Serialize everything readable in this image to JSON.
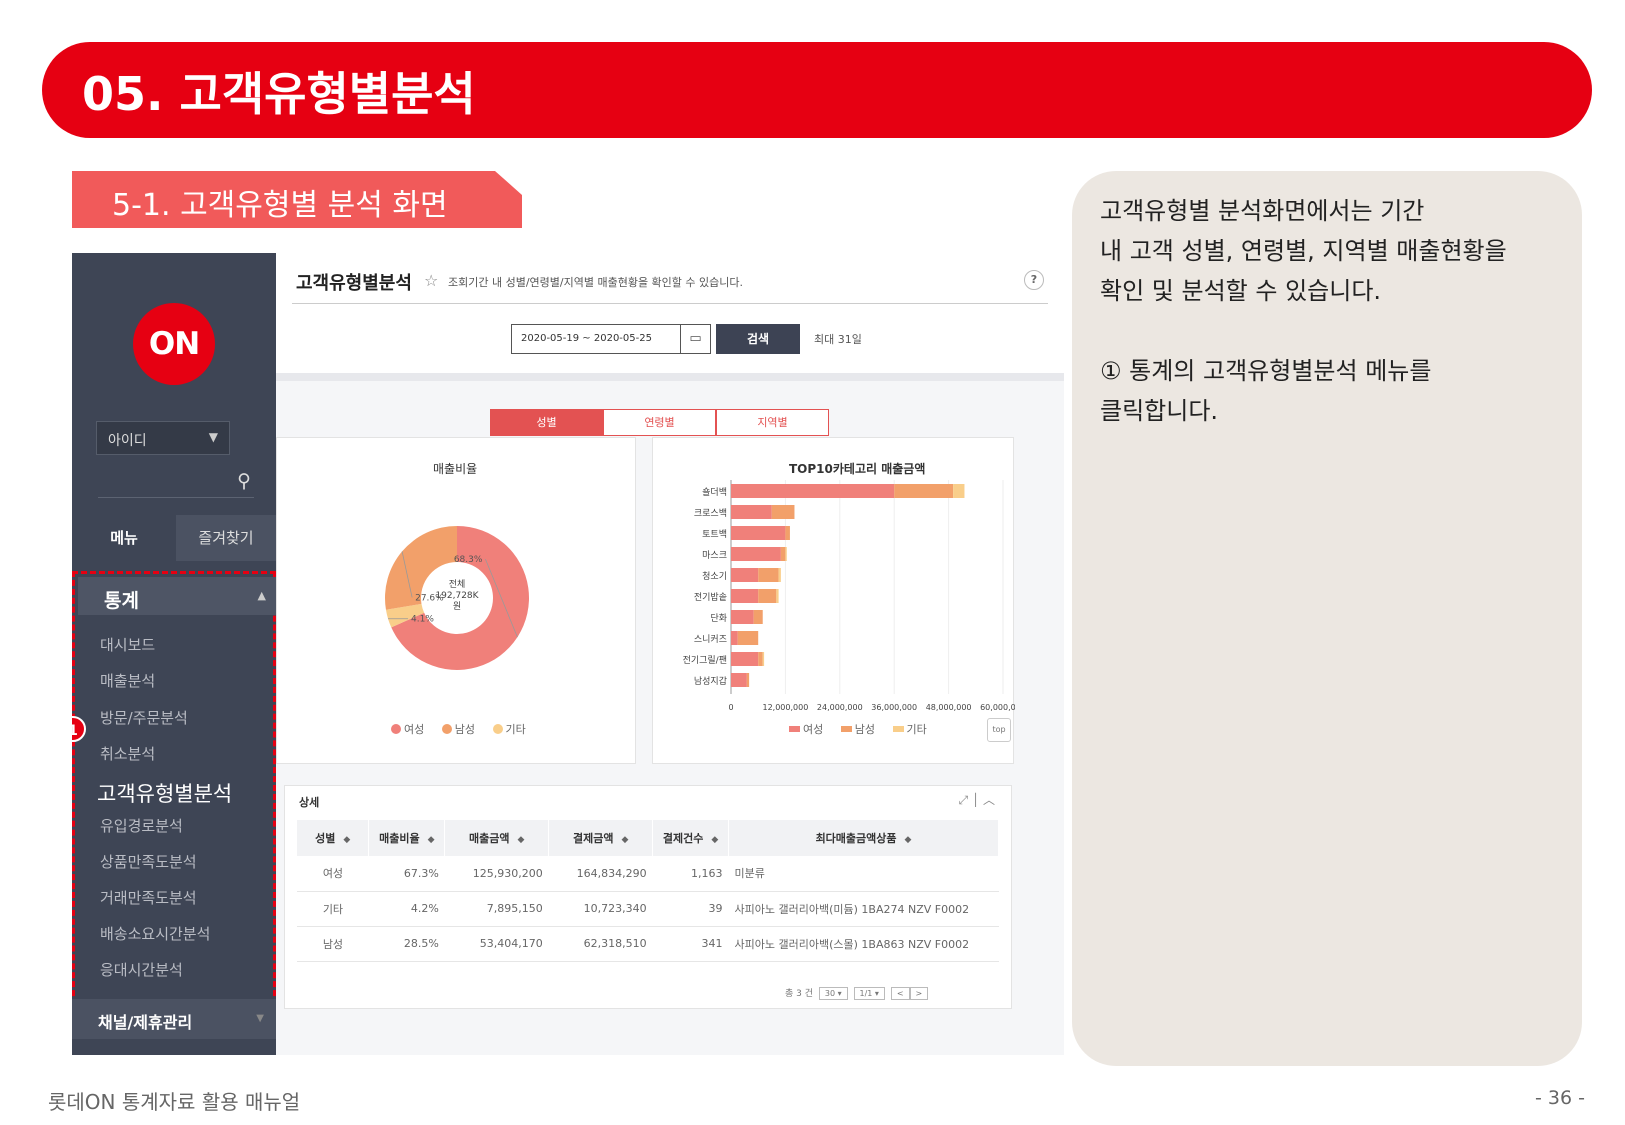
{
  "banner_title": "05. 고객유형별분석",
  "section_title": "5-1. 고객유형별 분석 화면",
  "description": [
    "고객유형별 분석화면에서는 기간",
    "내 고객 성별, 연령별, 지역별 매출현황을",
    "확인 및 분석할 수 있습니다.",
    "① 통계의 고객유형별분석 메뉴를",
    "클릭합니다."
  ],
  "footer": {
    "left": "롯데ON 통계자료 활용 매뉴얼",
    "right": "- 36 -"
  },
  "app": {
    "logo_text": "ON",
    "id_select": "아이디",
    "tabs": {
      "menu": "메뉴",
      "favorites": "즐겨찾기"
    },
    "group_title": "통계",
    "menu_items": [
      "대시보드",
      "매출분석",
      "방문/주문분석",
      "취소분석",
      "고객유형별분석",
      "유입경로분석",
      "상품만족도분석",
      "거래만족도분석",
      "배송소요시간분석",
      "응대시간분석"
    ],
    "active_index": 4,
    "badge": "1",
    "next_group": "채널/제휴관리"
  },
  "page": {
    "title": "고객유형별분석",
    "desc": "조회기간 내 성별/연령별/지역별 매출현황을 확인할 수 있습니다.",
    "help": "?",
    "date_range": "2020-05-19 ~ 2020-05-25",
    "search_label": "검색",
    "max_days": "최대 31일",
    "segments": [
      "성별",
      "연령별",
      "지역별"
    ],
    "selected_segment": "성별",
    "colors": {
      "female": "#f0807a",
      "male": "#f2a06a",
      "other": "#f9ce8a",
      "accent": "#e35252"
    }
  },
  "chart_data": [
    {
      "type": "pie",
      "title": "매출비율",
      "center_label": [
        "전체",
        "192,728K",
        "원"
      ],
      "labels": [
        "여성",
        "남성",
        "기타"
      ],
      "values": [
        68.3,
        27.6,
        4.1
      ],
      "value_labels": [
        "68.3%",
        "27.6%",
        "4.1%"
      ]
    },
    {
      "type": "bar",
      "orientation": "horizontal",
      "stacked": true,
      "title": "TOP10카테고리 매출금액",
      "categories": [
        "숄더백",
        "크로스백",
        "토트백",
        "마스크",
        "청소기",
        "전기밥솥",
        "단화",
        "스니커즈",
        "전기그릴/팬",
        "남성지갑"
      ],
      "series": [
        {
          "name": "여성",
          "values": [
            36000000,
            9000000,
            12000000,
            11000000,
            6000000,
            6000000,
            5000000,
            1500000,
            6000000,
            3500000
          ]
        },
        {
          "name": "남성",
          "values": [
            13000000,
            5000000,
            1000000,
            1000000,
            4500000,
            4000000,
            2000000,
            4500000,
            1000000,
            500000
          ]
        },
        {
          "name": "기타",
          "values": [
            2500000,
            0,
            0,
            300000,
            500000,
            500000,
            0,
            0,
            300000,
            0
          ]
        }
      ],
      "xlim": [
        0,
        60000000
      ],
      "x_ticks": [
        "0",
        "12,000,000",
        "24,000,000",
        "36,000,000",
        "48,000,000",
        "60,000,000"
      ],
      "grid": true,
      "legend": "bottom"
    }
  ],
  "top_button": "top",
  "detail": {
    "title": "상세",
    "headers": [
      "성별",
      "매출비율",
      "매출금액",
      "결제금액",
      "결제건수",
      "최다매출금액상품"
    ],
    "rows": [
      [
        "여성",
        "67.3%",
        "125,930,200",
        "164,834,290",
        "1,163",
        "미분류"
      ],
      [
        "기타",
        "4.2%",
        "7,895,150",
        "10,723,340",
        "39",
        "사피아노 갤러리아백(미듐) 1BA274 NZV F0002"
      ],
      [
        "남성",
        "28.5%",
        "53,404,170",
        "62,318,510",
        "341",
        "사피아노 갤러리아백(스몰) 1BA863 NZV F0002"
      ]
    ],
    "pager": {
      "total": "총 3 건",
      "per_page": "30",
      "page": "1/1"
    }
  }
}
